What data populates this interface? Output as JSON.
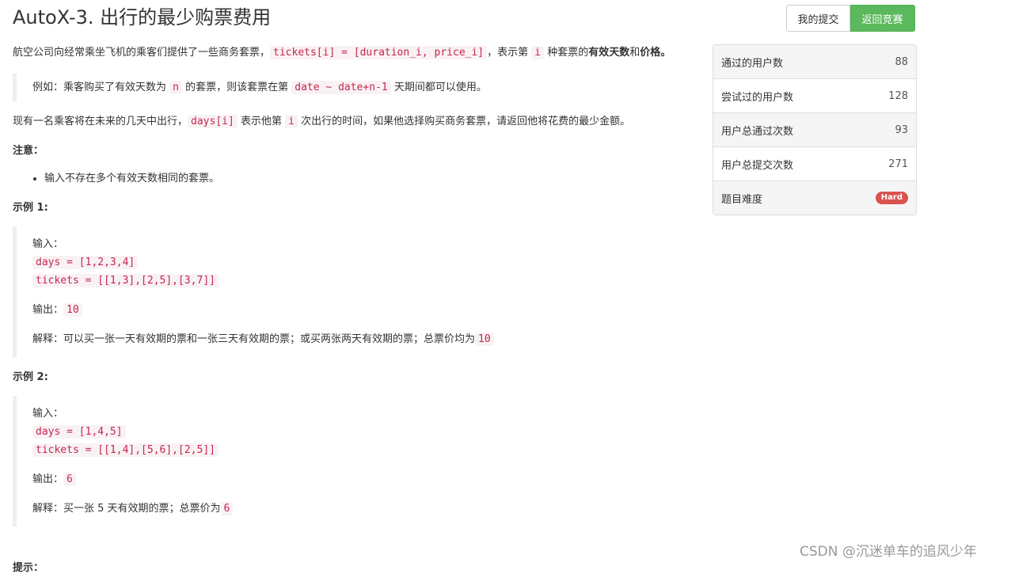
{
  "title": "AutoX-3. 出行的最少购票费用",
  "buttons": {
    "my_submissions": "我的提交",
    "back_to_contest": "返回竞赛"
  },
  "desc": {
    "p1_a": "航空公司向经常乘坐飞机的乘客们提供了一些商务套票，",
    "p1_code1": "tickets[i] = [duration_i, price_i]",
    "p1_b": "，表示第",
    "p1_code2": "i",
    "p1_c": "种套票的",
    "p1_strong": "有效天数",
    "p1_d": "和",
    "p1_strong2": "价格",
    "p1_e": "。",
    "quote_a": "例如：乘客购买了有效天数为",
    "quote_code1": "n",
    "quote_b": "的套票，则该套票在第",
    "quote_code2": "date ~ date+n-1",
    "quote_c": "天期间都可以使用。",
    "p2_a": "现有一名乘客将在未来的几天中出行，",
    "p2_code1": "days[i]",
    "p2_b": "表示他第",
    "p2_code2": "i",
    "p2_c": "次出行的时间，如果他选择购买商务套票，请返回他将花费的最少金额。",
    "note_title": "注意：",
    "notes": [
      "输入不存在多个有效天数相同的套票。"
    ]
  },
  "example1": {
    "title": "示例 1:",
    "input_label": "输入：",
    "days": "days = [1,2,3,4]",
    "tickets": "tickets = [[1,3],[2,5],[3,7]]",
    "output_label": "输出：",
    "output": "10",
    "explain_label": "解释：可以买一张一天有效期的票和一张三天有效期的票；或买两张两天有效期的票；总票价均为",
    "explain_value": "10"
  },
  "example2": {
    "title": "示例 2:",
    "input_label": "输入：",
    "days": "days = [1,4,5]",
    "tickets": "tickets = [[1,4],[5,6],[2,5]]",
    "output_label": "输出：",
    "output": "6",
    "explain_label": "解释：买一张 5 天有效期的票；总票价为",
    "explain_value": "6"
  },
  "cut_label": "提示：",
  "stats": [
    {
      "label": "通过的用户数",
      "value": "88"
    },
    {
      "label": "尝试过的用户数",
      "value": "128"
    },
    {
      "label": "用户总通过次数",
      "value": "93"
    },
    {
      "label": "用户总提交次数",
      "value": "271"
    }
  ],
  "difficulty": {
    "label": "题目难度",
    "value": "Hard",
    "color": "#d9534f"
  },
  "watermark": "CSDN @沉迷单车的追风少年"
}
